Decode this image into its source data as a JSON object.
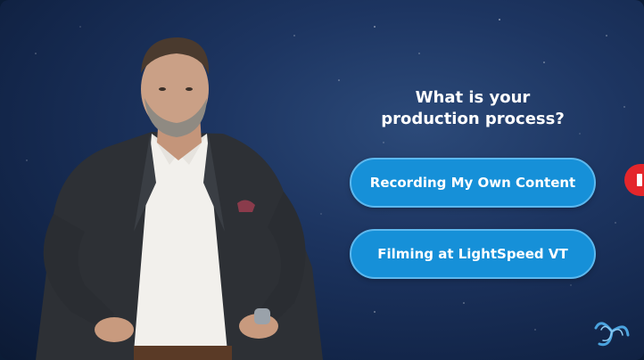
{
  "question": {
    "line1": "What is your",
    "line2": "production process?"
  },
  "choices": [
    {
      "label": "Recording My Own Content"
    },
    {
      "label": "Filming at LightSpeed VT"
    }
  ],
  "colors": {
    "button": "#1690d8",
    "button_border": "#5db8ee",
    "accent_tab": "#e4262b",
    "background": "#1d3561"
  },
  "icons": {
    "brand": "swirl-logo-icon",
    "side_tab": "red-tab-icon"
  }
}
